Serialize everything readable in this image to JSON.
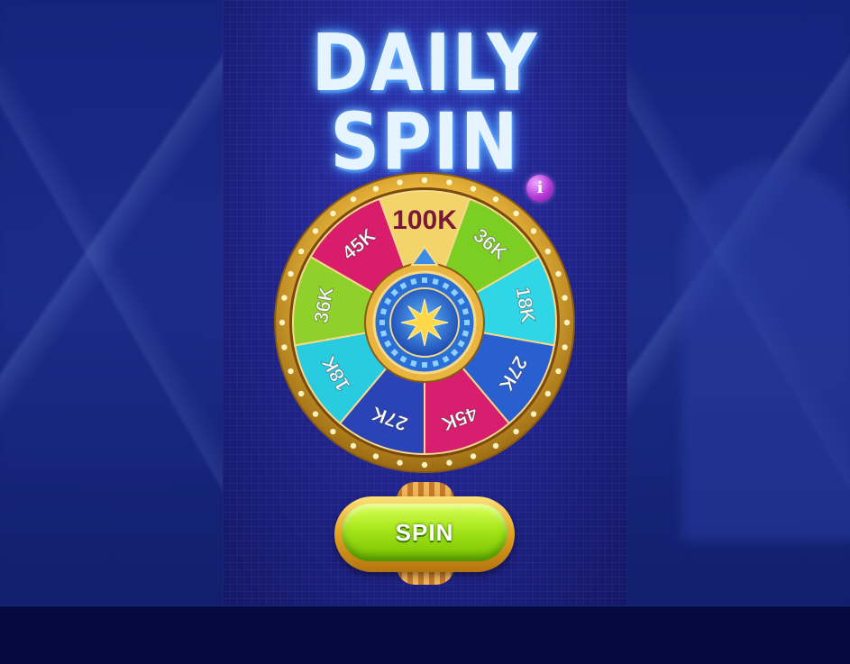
{
  "title": "DAILY SPIN",
  "info_icon": "i",
  "wheel": {
    "top_prize": "100K",
    "segments": [
      {
        "label": "100K",
        "color": "#f2d46a"
      },
      {
        "label": "36K",
        "color": "#7ccf22"
      },
      {
        "label": "18K",
        "color": "#2fd6e6"
      },
      {
        "label": "27K",
        "color": "#2a5fcf"
      },
      {
        "label": "45K",
        "color": "#d81e6e"
      },
      {
        "label": "27K",
        "color": "#2a44b8"
      },
      {
        "label": "18K",
        "color": "#29cbe0"
      },
      {
        "label": "36K",
        "color": "#8fd12a"
      },
      {
        "label": "45K",
        "color": "#d91c6c"
      }
    ],
    "rim_color": "#e6b23a",
    "hub_icon": "star-icon"
  },
  "spin_button": {
    "label": "SPIN"
  }
}
